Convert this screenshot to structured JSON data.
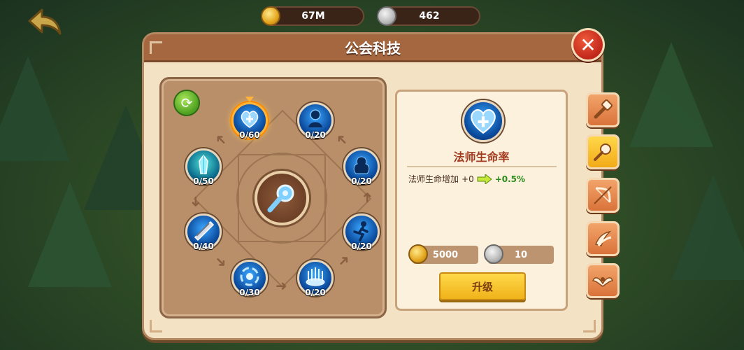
{
  "top_bar": {
    "gold_amount": "67M",
    "stone_amount": "462"
  },
  "panel": {
    "title": "公会科技"
  },
  "tech_nodes": [
    {
      "id": "mage-hp",
      "icon": "heart-plus-icon",
      "progress": "0/60",
      "selected": true
    },
    {
      "id": "mage-summon",
      "icon": "silhouette-icon",
      "progress": "0/20"
    },
    {
      "id": "mage-dark",
      "icon": "dark-figure-icon",
      "progress": "0/20"
    },
    {
      "id": "mage-sprint",
      "icon": "runner-icon",
      "progress": "0/20"
    },
    {
      "id": "mage-aura",
      "icon": "light-pillar-icon",
      "progress": "0/20"
    },
    {
      "id": "mage-spin",
      "icon": "vortex-icon",
      "progress": "0/30"
    },
    {
      "id": "mage-blade",
      "icon": "blade-icon",
      "progress": "0/40"
    },
    {
      "id": "mage-pillar",
      "icon": "crystal-pillar-icon",
      "progress": "0/50"
    }
  ],
  "detail": {
    "name": "法师生命率",
    "stat_label": "法师生命增加",
    "stat_current": "+0",
    "stat_next": "+0.5%",
    "cost_gold": "5000",
    "cost_stone": "10",
    "upgrade_label": "升级"
  },
  "side_tabs": [
    {
      "icon": "hammer-icon",
      "active": false
    },
    {
      "icon": "wand-icon",
      "active": true
    },
    {
      "icon": "bow-icon",
      "active": false
    },
    {
      "icon": "claw-icon",
      "active": false
    },
    {
      "icon": "wings-icon",
      "active": false
    }
  ],
  "colors": {
    "title_text": "#a23a1f",
    "green_value": "#2d8a1c",
    "upgrade_button": "#f0b21a",
    "close_button": "#c0271a"
  }
}
